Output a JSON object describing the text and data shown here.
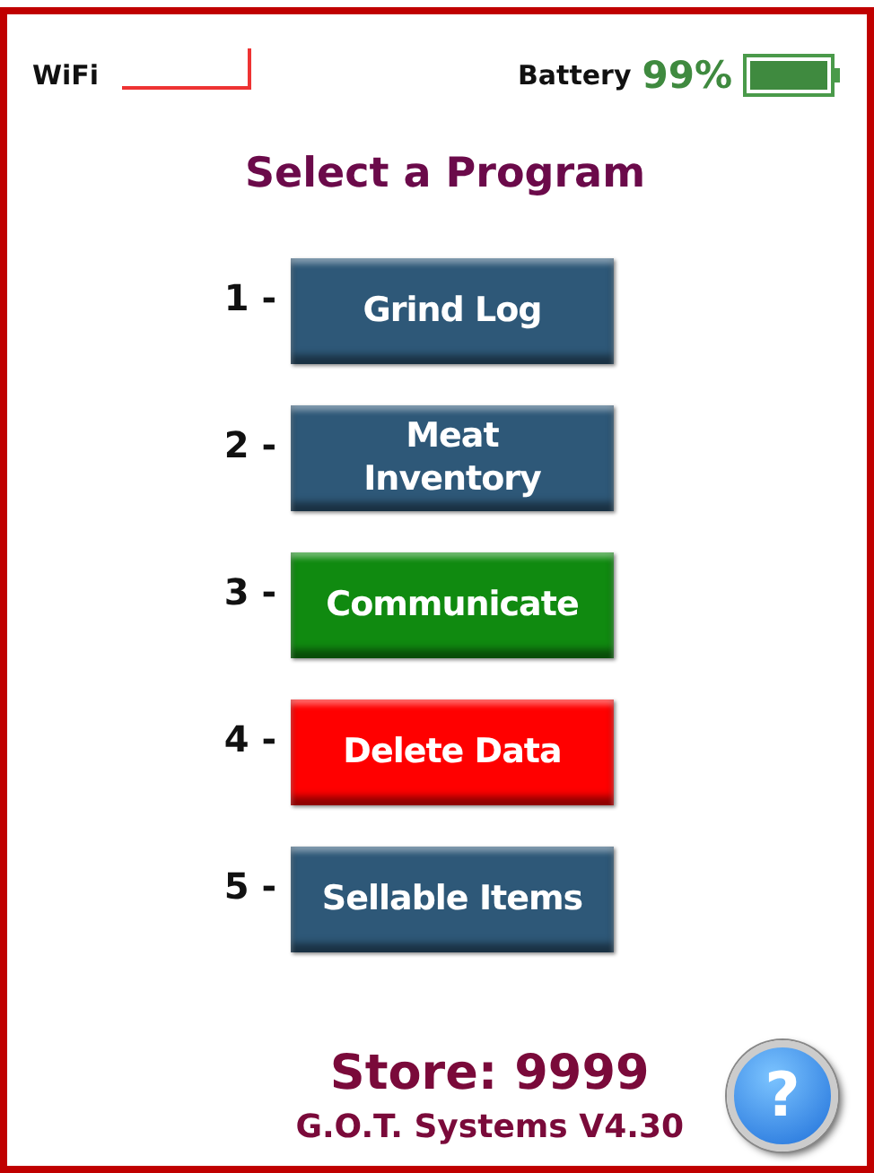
{
  "status_bar": {
    "wifi_label": "WiFi",
    "battery_label": "Battery",
    "battery_percent": "99%"
  },
  "title": "Select a Program",
  "programs": [
    {
      "number": "1 -",
      "label": "Grind Log",
      "color": "#2e5878"
    },
    {
      "number": "2 -",
      "label": "Meat\nInventory",
      "color": "#2e5878"
    },
    {
      "number": "3 -",
      "label": "Communicate",
      "color": "#108a10"
    },
    {
      "number": "4 -",
      "label": "Delete Data",
      "color": "#ff0000"
    },
    {
      "number": "5 -",
      "label": "Sellable Items",
      "color": "#2e5878"
    }
  ],
  "footer": {
    "store": "Store: 9999",
    "version": "G.O.T. Systems V4.30",
    "help_button": "?"
  }
}
